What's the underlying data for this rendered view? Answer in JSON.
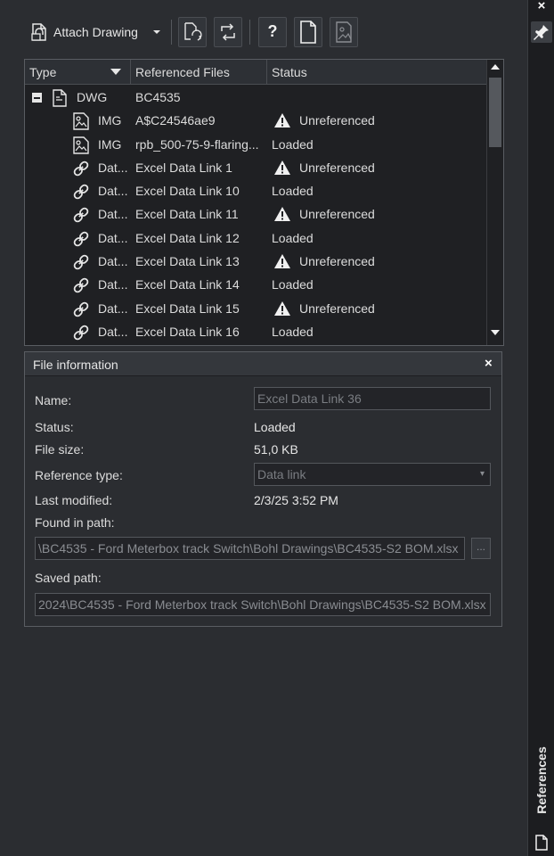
{
  "toolbar": {
    "attach_label": "Attach Drawing",
    "help_label": "?"
  },
  "references": {
    "columns": [
      "Type",
      "Referenced Files",
      "Status"
    ],
    "rows": [
      {
        "type": "DWG",
        "name": "BC4535",
        "status": "",
        "warn": false,
        "icon": "drawing-icon",
        "expand": "−"
      },
      {
        "type": "IMG",
        "name": "A$C24546ae9",
        "status": "Unreferenced",
        "warn": true,
        "icon": "image-icon"
      },
      {
        "type": "IMG",
        "name": "rpb_500-75-9-flaring...",
        "status": "Loaded",
        "warn": false,
        "icon": "image-icon"
      },
      {
        "type": "Dat...",
        "name": "Excel Data Link 1",
        "status": "Unreferenced",
        "warn": true,
        "icon": "data-link-icon"
      },
      {
        "type": "Dat...",
        "name": "Excel Data Link 10",
        "status": "Loaded",
        "warn": false,
        "icon": "data-link-icon"
      },
      {
        "type": "Dat...",
        "name": "Excel Data Link 11",
        "status": "Unreferenced",
        "warn": true,
        "icon": "data-link-icon"
      },
      {
        "type": "Dat...",
        "name": "Excel Data Link 12",
        "status": "Loaded",
        "warn": false,
        "icon": "data-link-icon"
      },
      {
        "type": "Dat...",
        "name": "Excel Data Link 13",
        "status": "Unreferenced",
        "warn": true,
        "icon": "data-link-icon"
      },
      {
        "type": "Dat...",
        "name": "Excel Data Link 14",
        "status": "Loaded",
        "warn": false,
        "icon": "data-link-icon"
      },
      {
        "type": "Dat...",
        "name": "Excel Data Link 15",
        "status": "Unreferenced",
        "warn": true,
        "icon": "data-link-icon"
      },
      {
        "type": "Dat...",
        "name": "Excel Data Link 16",
        "status": "Loaded",
        "warn": false,
        "icon": "data-link-icon"
      }
    ]
  },
  "file_info": {
    "title": "File information",
    "name_label": "Name:",
    "name_value": "Excel Data Link 36",
    "status_label": "Status:",
    "status_value": "Loaded",
    "size_label": "File size:",
    "size_value": "51,0 KB",
    "reftype_label": "Reference type:",
    "reftype_value": "Data link",
    "modified_label": "Last modified:",
    "modified_value": "2/3/25 3:52 PM",
    "found_label": "Found in path:",
    "found_value": "\\BC4535 - Ford Meterbox track Switch\\Bohl Drawings\\BC4535-S2 BOM.xlsx",
    "browse_label": "...",
    "saved_label": "Saved path:",
    "saved_value": "2024\\BC4535 - Ford Meterbox track Switch\\Bohl Drawings\\BC4535-S2 BOM.xlsx"
  },
  "dock": {
    "label": "References",
    "close": "×"
  },
  "colors": {
    "background": "#2b2d31",
    "list_background": "#1f2023",
    "text": "#dcdcdc",
    "disabled_text": "#7a7d82"
  }
}
